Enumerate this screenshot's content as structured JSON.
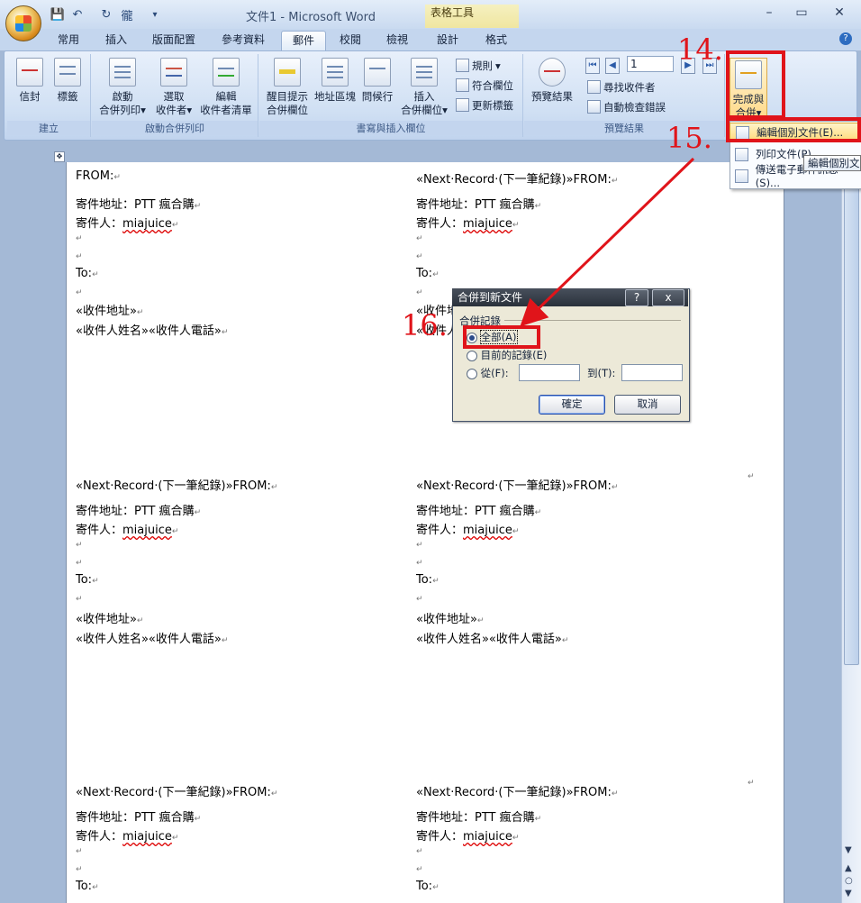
{
  "window": {
    "title": "文件1 - Microsoft Word",
    "context_tools": "表格工具",
    "qat_extra": "徿"
  },
  "tabs": [
    "常用",
    "插入",
    "版面配置",
    "參考資料",
    "郵件",
    "校閱",
    "檢視",
    "設計",
    "格式"
  ],
  "active_tab": "郵件",
  "ribbon": {
    "groups": {
      "create": "建立",
      "start_merge": "啟動合併列印",
      "write_insert": "書寫與插入欄位",
      "preview": "預覽結果",
      "finish": ""
    },
    "buttons": {
      "envelopes": "信封",
      "labels": "標籤",
      "start_merge_1": "啟動",
      "start_merge_2": "合併列印",
      "select_recipients_1": "選取",
      "select_recipients_2": "收件者",
      "edit_list_1": "編輯",
      "edit_list_2": "收件者清單",
      "highlight_1": "醒目提示",
      "highlight_2": "合併欄位",
      "address_block": "地址區塊",
      "greeting_line": "問候行",
      "insert_field_1": "插入",
      "insert_field_2": "合併欄位",
      "rules": "規則",
      "match_fields": "符合欄位",
      "update_labels": "更新標籤",
      "preview_results": "預覽結果",
      "record_number": "1",
      "find_recipient": "尋找收件者",
      "auto_check": "自動檢查錯誤",
      "finish_merge_1": "完成與",
      "finish_merge_2": "合併"
    }
  },
  "menu": {
    "items": [
      "編輯個別文件(E)...",
      "列印文件(P)...",
      "傳送電子郵件訊息(S)..."
    ],
    "tooltip": "編輯個別文"
  },
  "document": {
    "first_label": {
      "from": "FROM:",
      "addr": "寄件地址：PTT 瘋合購",
      "sender_prefix": "寄件人：",
      "sender_name": "miajuice",
      "to": "To:",
      "recv_addr": "«收件地址»",
      "recv_name": "«收件人姓名»«收件人電話»"
    },
    "next_from": "«Next·Record·(下一筆紀錄)»FROM:",
    "pilcrow": "↵"
  },
  "dialog": {
    "title": "合併到新文件",
    "help": "?",
    "close": "x",
    "section": "合併記錄",
    "opt_all": "全部(A)",
    "opt_current": "目前的記錄(E)",
    "opt_from": "從(F):",
    "to_label": "到(T):",
    "ok": "確定",
    "cancel": "取消"
  },
  "annotations": [
    "14.",
    "15.",
    "16."
  ],
  "colors": {
    "annotation": "#e0141a",
    "ribbon": "#cfdff3"
  }
}
